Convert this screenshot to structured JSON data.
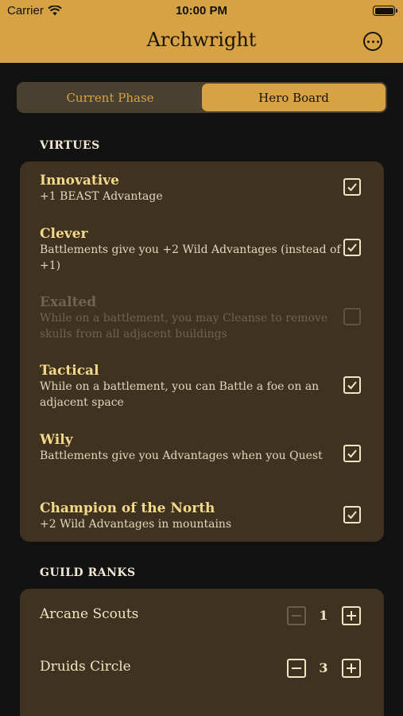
{
  "status_bar": {
    "carrier": "Carrier",
    "time": "10:00 PM"
  },
  "nav": {
    "title": "Archwright",
    "more_icon": "ellipsis-circle-icon"
  },
  "segments": [
    {
      "label": "Current Phase",
      "selected": false
    },
    {
      "label": "Hero Board",
      "selected": true
    }
  ],
  "virtues": {
    "header": "VIRTUES",
    "items": [
      {
        "name": "Innovative",
        "description": "+1 BEAST Advantage",
        "checked": true,
        "enabled": true
      },
      {
        "name": "Clever",
        "description": "Battlements give you +2 Wild Advantages (instead of +1)",
        "checked": true,
        "enabled": true
      },
      {
        "name": "Exalted",
        "description": "While on a battlement, you may Cleanse to remove skulls from all adjacent buildings",
        "checked": false,
        "enabled": false
      },
      {
        "name": "Tactical",
        "description": "While on a battlement, you can Battle a foe on an adjacent space",
        "checked": true,
        "enabled": true
      },
      {
        "name": "Wily",
        "description": "Battlements give you Advantages when you Quest",
        "checked": true,
        "enabled": true
      },
      {
        "name": "Champion of the North",
        "description": "+2 Wild Advantages in mountains",
        "checked": true,
        "enabled": true
      }
    ]
  },
  "guild_ranks": {
    "header": "GUILD RANKS",
    "items": [
      {
        "name": "Arcane Scouts",
        "value": "1"
      },
      {
        "name": "Druids Circle",
        "value": "3"
      }
    ]
  },
  "colors": {
    "accent": "#d6a243",
    "card": "#3f3220",
    "background": "#121212"
  }
}
